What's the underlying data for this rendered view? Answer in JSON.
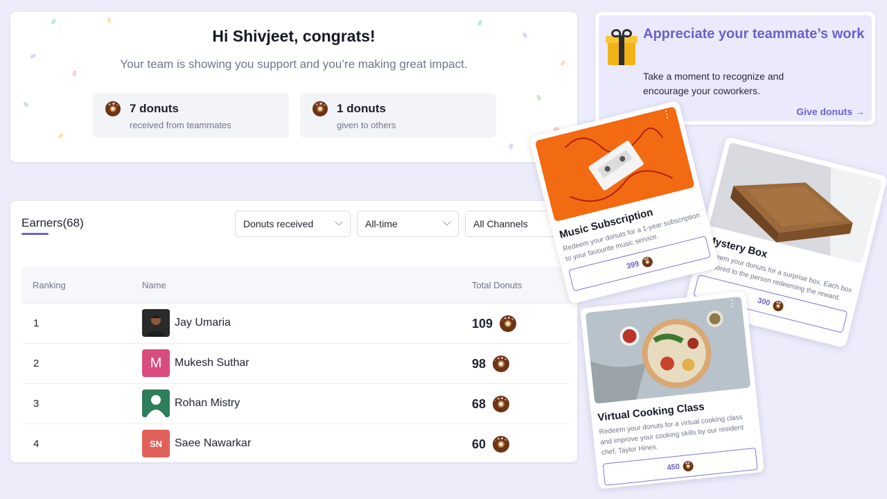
{
  "congrats": {
    "title": "Hi Shivjeet, congrats!",
    "subtitle": "Your team is showing you support and you’re making great impact.",
    "stats": [
      {
        "value": "7 donuts",
        "label": "received from teammates"
      },
      {
        "value": "1 donuts",
        "label": "given to others"
      }
    ]
  },
  "appreciate": {
    "title": "Appreciate your teammate’s work",
    "body": "Take a moment to recognize and encourage your coworkers.",
    "link": "Give donuts →"
  },
  "earners": {
    "tab": "Earners(68)",
    "filters": [
      "Donuts received",
      "All-time",
      "All Channels"
    ],
    "columns": [
      "Ranking",
      "Name",
      "Total Donuts"
    ],
    "rows": [
      {
        "rank": "1",
        "name": "Jay Umaria",
        "initials": "",
        "avatar_color": "#2b2b2b",
        "total": "109"
      },
      {
        "rank": "2",
        "name": "Mukesh Suthar",
        "initials": "M",
        "avatar_color": "#d94d7e",
        "total": "98"
      },
      {
        "rank": "3",
        "name": "Rohan Mistry",
        "initials": "",
        "avatar_color": "#2e7d5b",
        "total": "68"
      },
      {
        "rank": "4",
        "name": "Saee Nawarkar",
        "initials": "SN",
        "avatar_color": "#e0605a",
        "total": "60"
      }
    ]
  },
  "rewards": [
    {
      "title": "Music Subscription",
      "desc": "Redeem your donuts for a 1-year subscription to your favourite music service.",
      "price": "399"
    },
    {
      "title": "Mystery Box",
      "desc": "Redeem your donuts for a surprise box. Each box is tailored to the person redeeming the reward.",
      "price": "300"
    },
    {
      "title": "Virtual Cooking Class",
      "desc": "Redeem your donuts for a virtual cooking class and improve your cooking skills by our resident chef, Taylor Hines.",
      "price": "450"
    }
  ],
  "colors": {
    "accent": "#6a62cf",
    "background": "#ececfb"
  }
}
